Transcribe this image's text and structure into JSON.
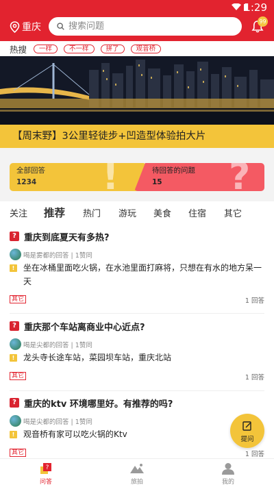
{
  "status": {
    "time": "1:29"
  },
  "header": {
    "city": "重庆",
    "search_placeholder": "搜索问题",
    "notification_count": "99"
  },
  "hot_search": {
    "label": "热搜",
    "tags": [
      "一样",
      "不一样",
      "拼了",
      "观音桥"
    ]
  },
  "banner": {
    "caption": "【周末野】3公里轻徒步+凹造型体验拍大片"
  },
  "stats": {
    "all_answers": {
      "label": "全部回答",
      "count": "1234"
    },
    "pending": {
      "label": "待回答的问题",
      "count": "15"
    }
  },
  "tabs": [
    "关注",
    "推荐",
    "热门",
    "游玩",
    "美食",
    "住宿",
    "其它"
  ],
  "active_tab": "推荐",
  "questions": [
    {
      "title": "重庆到底夏天有多热?",
      "user": "喝是雾都",
      "suffix": "的回答",
      "likes": "1赞同",
      "answer": "坐在冰桶里面吃火锅，在水池里面打麻将，只想在有水的地方呆一天",
      "category": "其它",
      "answer_count": "1 回答"
    },
    {
      "title": "重庆那个车站离商业中心近点?",
      "user": "喝是尖都",
      "suffix": "的回答",
      "likes": "1赞同",
      "answer": "龙头寺长途车站，菜园坝车站，重庆北站",
      "category": "其它",
      "answer_count": "1 回答"
    },
    {
      "title": "重庆的ktv 环境哪里好。有推荐的吗?",
      "user": "喝是尖都",
      "suffix": "的回答",
      "likes": "1赞同",
      "answer": "观音桥有家可以吃火锅的Ktv",
      "category": "其它",
      "answer_count": "1 回答"
    }
  ],
  "fab": {
    "label": "提问"
  },
  "nav": [
    {
      "label": "问答",
      "icon": "qa-icon"
    },
    {
      "label": "旅拍",
      "icon": "mountain-photo-icon"
    },
    {
      "label": "我的",
      "icon": "user-icon"
    }
  ],
  "colors": {
    "brand_red": "#e2232f",
    "accent_yellow": "#f3c43a",
    "pending_red": "#f45a63"
  }
}
